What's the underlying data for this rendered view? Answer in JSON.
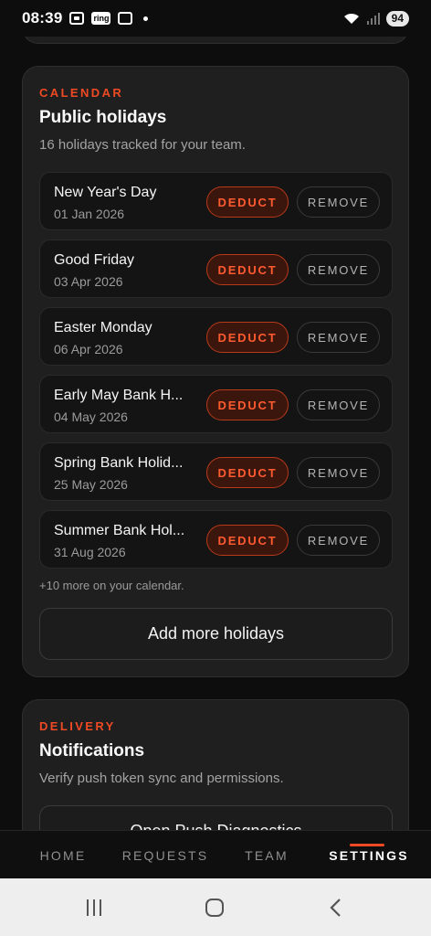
{
  "status_bar": {
    "time": "08:39",
    "ring_label": "ring",
    "battery": "94"
  },
  "calendar": {
    "eyebrow": "CALENDAR",
    "title": "Public holidays",
    "subtitle": "16 holidays tracked for your team.",
    "holidays": [
      {
        "name": "New Year's Day",
        "date": "01 Jan 2026"
      },
      {
        "name": "Good Friday",
        "date": "03 Apr 2026"
      },
      {
        "name": "Easter Monday",
        "date": "06 Apr 2026"
      },
      {
        "name": "Early May Bank H...",
        "date": "04 May 2026"
      },
      {
        "name": "Spring Bank Holid...",
        "date": "25 May 2026"
      },
      {
        "name": "Summer Bank Hol...",
        "date": "31 Aug 2026"
      }
    ],
    "deduct_label": "DEDUCT",
    "remove_label": "REMOVE",
    "more_note": "+10 more on your calendar.",
    "add_button": "Add more holidays"
  },
  "delivery": {
    "eyebrow": "DELIVERY",
    "title": "Notifications",
    "subtitle": "Verify push token sync and permissions.",
    "button": "Open Push Diagnostics"
  },
  "nav": {
    "items": [
      "HOME",
      "REQUESTS",
      "TEAM",
      "SETTINGS"
    ],
    "active": "SETTINGS"
  },
  "colors": {
    "accent": "#ef4a23",
    "background": "#0d0d0d",
    "card": "#1f1f1f"
  }
}
